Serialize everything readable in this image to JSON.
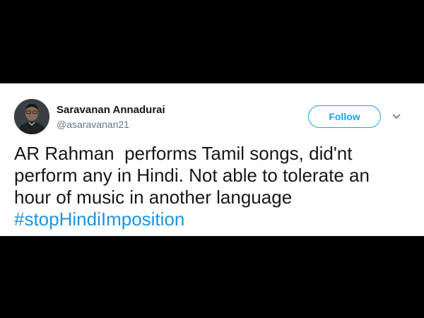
{
  "tweet": {
    "author": {
      "display_name": "Saravanan Annadurai",
      "handle": "@asaravanan21"
    },
    "follow_label": "Follow",
    "text_lines": [
      "AR Rahman  performs Tamil songs, did'nt",
      "perform any in Hindi. Not able to tolerate an",
      "hour of music in another language"
    ],
    "hashtag": "#stopHindiImposition"
  },
  "colors": {
    "background": "#000000",
    "card": "#ffffff",
    "accent": "#1da1f2",
    "hashtag": "#1b95e0",
    "text": "#14171a",
    "muted": "#657786"
  },
  "icons": {
    "menu": "chevron-down-icon"
  }
}
